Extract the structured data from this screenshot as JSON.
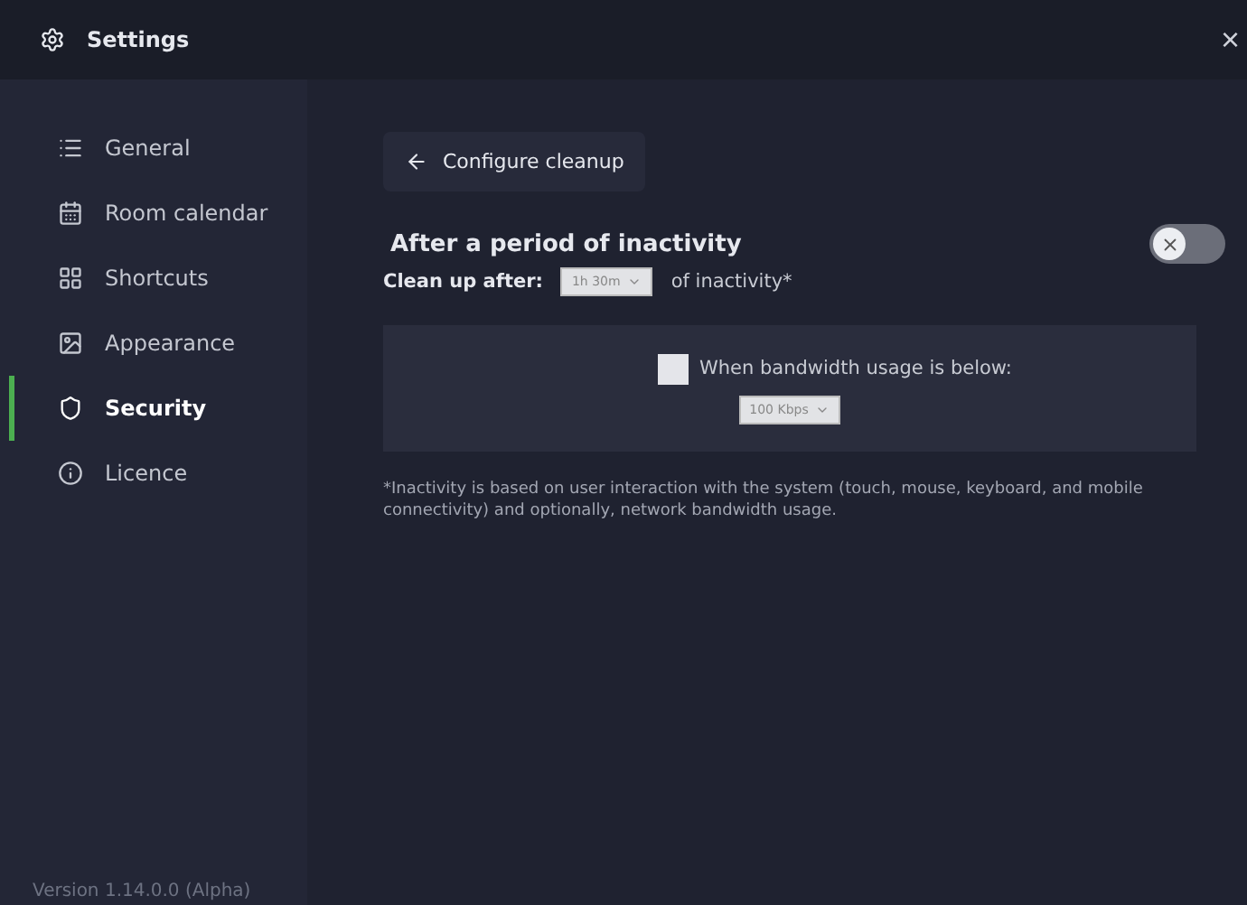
{
  "window": {
    "title": "Settings",
    "close": "×"
  },
  "sidebar": {
    "items": [
      {
        "label": "General",
        "selected": false
      },
      {
        "label": "Room calendar",
        "selected": false
      },
      {
        "label": "Shortcuts",
        "selected": false
      },
      {
        "label": "Appearance",
        "selected": false
      },
      {
        "label": "Security",
        "selected": true
      },
      {
        "label": "Licence",
        "selected": false
      }
    ],
    "version": "Version 1.14.0.0 (Alpha)"
  },
  "back_button": {
    "label": "Configure cleanup"
  },
  "section": {
    "title": "After a period of inactivity",
    "toggle_on": false,
    "clean_up_label": "Clean up after:",
    "clean_up_value": "1h 30m",
    "clean_up_suffix": "of inactivity*",
    "bandwidth": {
      "checked": false,
      "label": "When bandwidth usage is below:",
      "value": "100 Kbps"
    },
    "footnote": "*Inactivity is based on user interaction with the system (touch, mouse, keyboard, and mobile connectivity) and optionally, network bandwidth usage."
  }
}
